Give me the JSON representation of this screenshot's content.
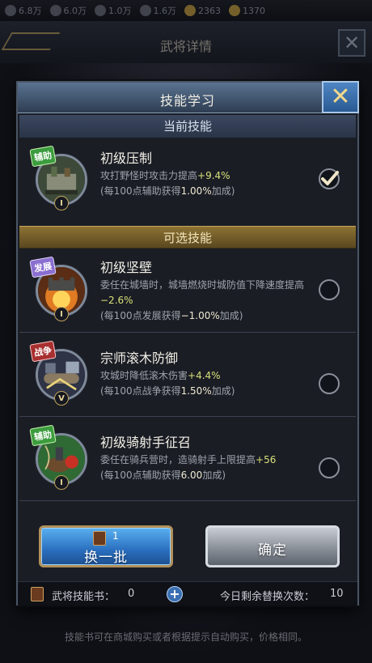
{
  "resources": [
    {
      "icon": "grain-icon",
      "value": "6.8万"
    },
    {
      "icon": "wood-icon",
      "value": "6.0万"
    },
    {
      "icon": "stone-icon",
      "value": "1.0万"
    },
    {
      "icon": "iron-icon",
      "value": "1.6万"
    },
    {
      "icon": "coin-icon",
      "value": "2363"
    },
    {
      "icon": "gold-ingot-icon",
      "value": "1370"
    }
  ],
  "background_page": {
    "title": "武将详情",
    "close_glyph": "✕",
    "footer_text": "技能书可在商城购买或者根据提示自动购买，价格相同。"
  },
  "modal": {
    "title": "技能学习",
    "close_glyph": "✕",
    "current_section": "当前技能",
    "optional_section": "可选技能",
    "current_skill": {
      "name": "初级压制",
      "tag": "辅助",
      "tier": "I",
      "desc_line1_prefix": "攻打野怪时攻击力提高",
      "desc_line1_value": "+9.4%",
      "desc_line2_prefix": "(每100点辅助获得",
      "desc_line2_value": "1.00%",
      "desc_line2_suffix": "加成)",
      "selected": true
    },
    "optional_skills": [
      {
        "name": "初级坚壁",
        "tag": "发展",
        "tier": "I",
        "desc_line1_prefix": "委任在城墙时，城墙燃烧时城防值下降速度提高",
        "desc_line1_value": "−2.6%",
        "desc_line2_prefix": "(每100点发展获得",
        "desc_line2_value": "−1.00%",
        "desc_line2_suffix": "加成)"
      },
      {
        "name": "宗师滚木防御",
        "tag": "战争",
        "tier": "V",
        "desc_line1_prefix": "攻城时降低滚木伤害",
        "desc_line1_value": "+4.4%",
        "desc_line2_prefix": "(每100点战争获得",
        "desc_line2_value": "1.50%",
        "desc_line2_suffix": "加成)"
      },
      {
        "name": "初级骑射手征召",
        "tag": "辅助",
        "tier": "I",
        "desc_line1_prefix": "委任在骑兵营时，造骑射手上限提高",
        "desc_line1_value": "+56",
        "desc_line2_prefix": "(每100点辅助获得",
        "desc_line2_value": "6.00",
        "desc_line2_suffix": "加成)"
      }
    ],
    "refresh_button": {
      "label": "换一批",
      "cost": "1"
    },
    "confirm_button": {
      "label": "确定"
    },
    "footer": {
      "books_label": "武将技能书：",
      "books_value": "0",
      "add_glyph": "+",
      "remaining_label": "今日剩余替换次数：",
      "remaining_value": "10"
    }
  },
  "colors": {
    "highlight_value": "#d9e07a",
    "gold_section": "#8d7233",
    "blue_button": "#2a6fbf"
  }
}
